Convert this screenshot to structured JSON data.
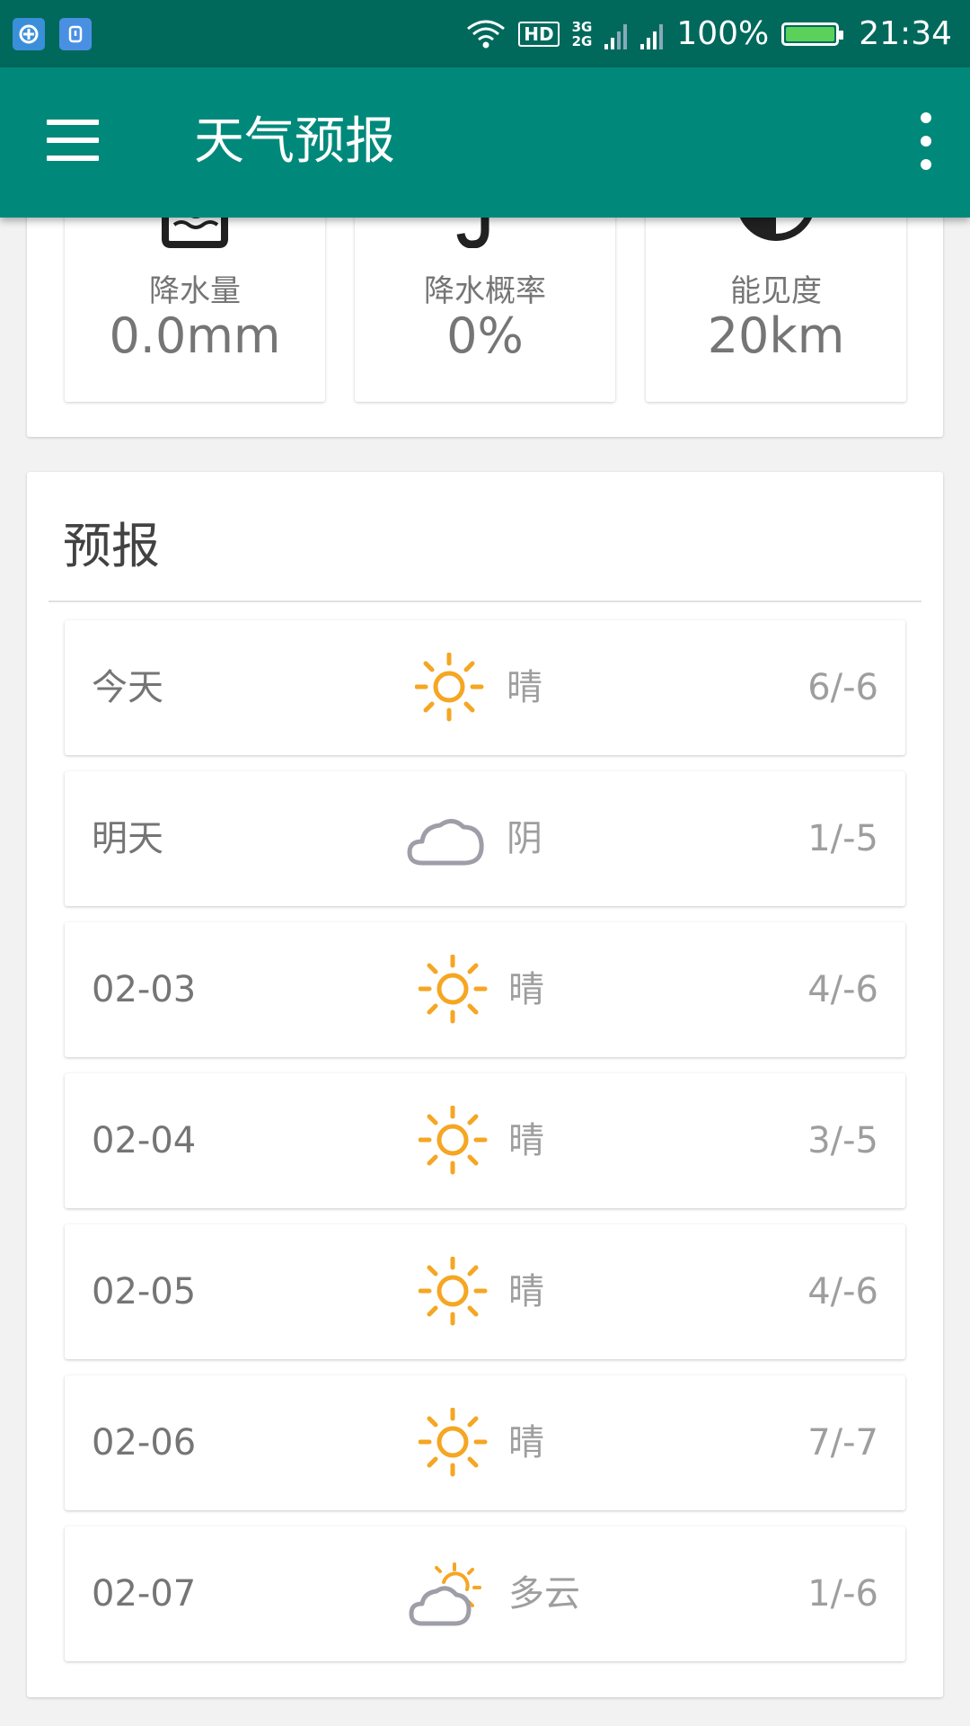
{
  "status_bar": {
    "wifi_icon": "wifi-icon",
    "hd_label": "HD",
    "network_label_top": "3G",
    "network_label_bottom": "2G",
    "battery_percent": "100%",
    "battery_level": 1.0,
    "time": "21:34"
  },
  "app_bar": {
    "title": "天气预报",
    "menu_icon": "hamburger-menu-icon",
    "more_icon": "more-vert-icon"
  },
  "metrics": [
    {
      "label": "降水量",
      "value": "0.0mm",
      "icon": "precipitation-icon"
    },
    {
      "label": "降水概率",
      "value": "0%",
      "icon": "umbrella-icon"
    },
    {
      "label": "能见度",
      "value": "20km",
      "icon": "visibility-icon"
    }
  ],
  "forecast": {
    "title": "预报",
    "days": [
      {
        "date": "今天",
        "condition": "晴",
        "icon": "sun-icon",
        "temp": "6/-6"
      },
      {
        "date": "明天",
        "condition": "阴",
        "icon": "cloud-icon",
        "temp": "1/-5"
      },
      {
        "date": "02-03",
        "condition": "晴",
        "icon": "sun-icon",
        "temp": "4/-6"
      },
      {
        "date": "02-04",
        "condition": "晴",
        "icon": "sun-icon",
        "temp": "3/-5"
      },
      {
        "date": "02-05",
        "condition": "晴",
        "icon": "sun-icon",
        "temp": "4/-6"
      },
      {
        "date": "02-06",
        "condition": "晴",
        "icon": "sun-icon",
        "temp": "7/-7"
      },
      {
        "date": "02-07",
        "condition": "多云",
        "icon": "partly-cloudy-icon",
        "temp": "1/-6"
      }
    ]
  },
  "colors": {
    "status_bar": "#00695c",
    "app_bar": "#00897b",
    "sun": "#f5a623",
    "cloud": "#9e9ea8",
    "battery": "#5bd05b"
  }
}
